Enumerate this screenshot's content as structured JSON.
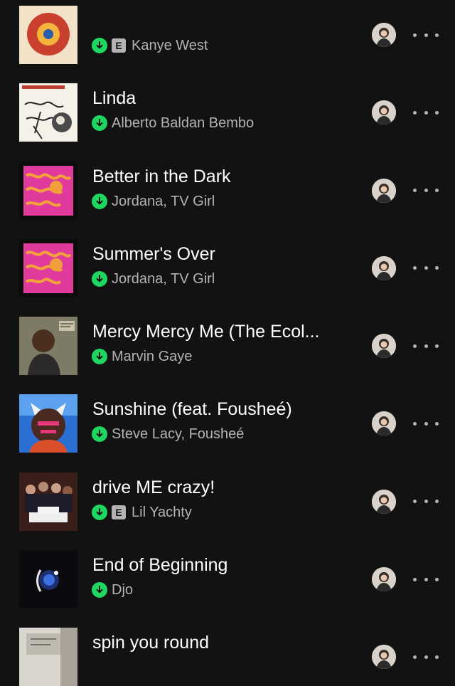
{
  "rows": [
    {
      "title": "",
      "artist": "Kanye West",
      "explicit": true,
      "art": "art-colorful"
    },
    {
      "title": "Linda",
      "artist": "Alberto Baldan Bembo",
      "explicit": false,
      "art": "art-sketch"
    },
    {
      "title": "Better in the Dark",
      "artist": "Jordana, TV Girl",
      "explicit": false,
      "art": "art-pink"
    },
    {
      "title": "Summer's Over",
      "artist": "Jordana, TV Girl",
      "explicit": false,
      "art": "art-pink"
    },
    {
      "title": "Mercy Mercy Me (The Ecol...",
      "artist": "Marvin Gaye",
      "explicit": false,
      "art": "art-portrait"
    },
    {
      "title": "Sunshine (feat. Fousheé)",
      "artist": "Steve Lacy, Fousheé",
      "explicit": false,
      "art": "art-blue"
    },
    {
      "title": "drive ME crazy!",
      "artist": "Lil Yachty",
      "explicit": true,
      "art": "art-group"
    },
    {
      "title": "End of Beginning",
      "artist": "Djo",
      "explicit": false,
      "art": "art-dark"
    },
    {
      "title": "spin you round",
      "artist": "",
      "explicit": false,
      "art": "art-light"
    }
  ],
  "explicit_badge": "E",
  "colors": {
    "background": "#121212",
    "download_green": "#1ed760",
    "secondary_text": "#b3b3b3"
  },
  "icons": {
    "download": "download-arrow-icon",
    "more": "more-options-icon",
    "avatar": "added-by-avatar"
  }
}
